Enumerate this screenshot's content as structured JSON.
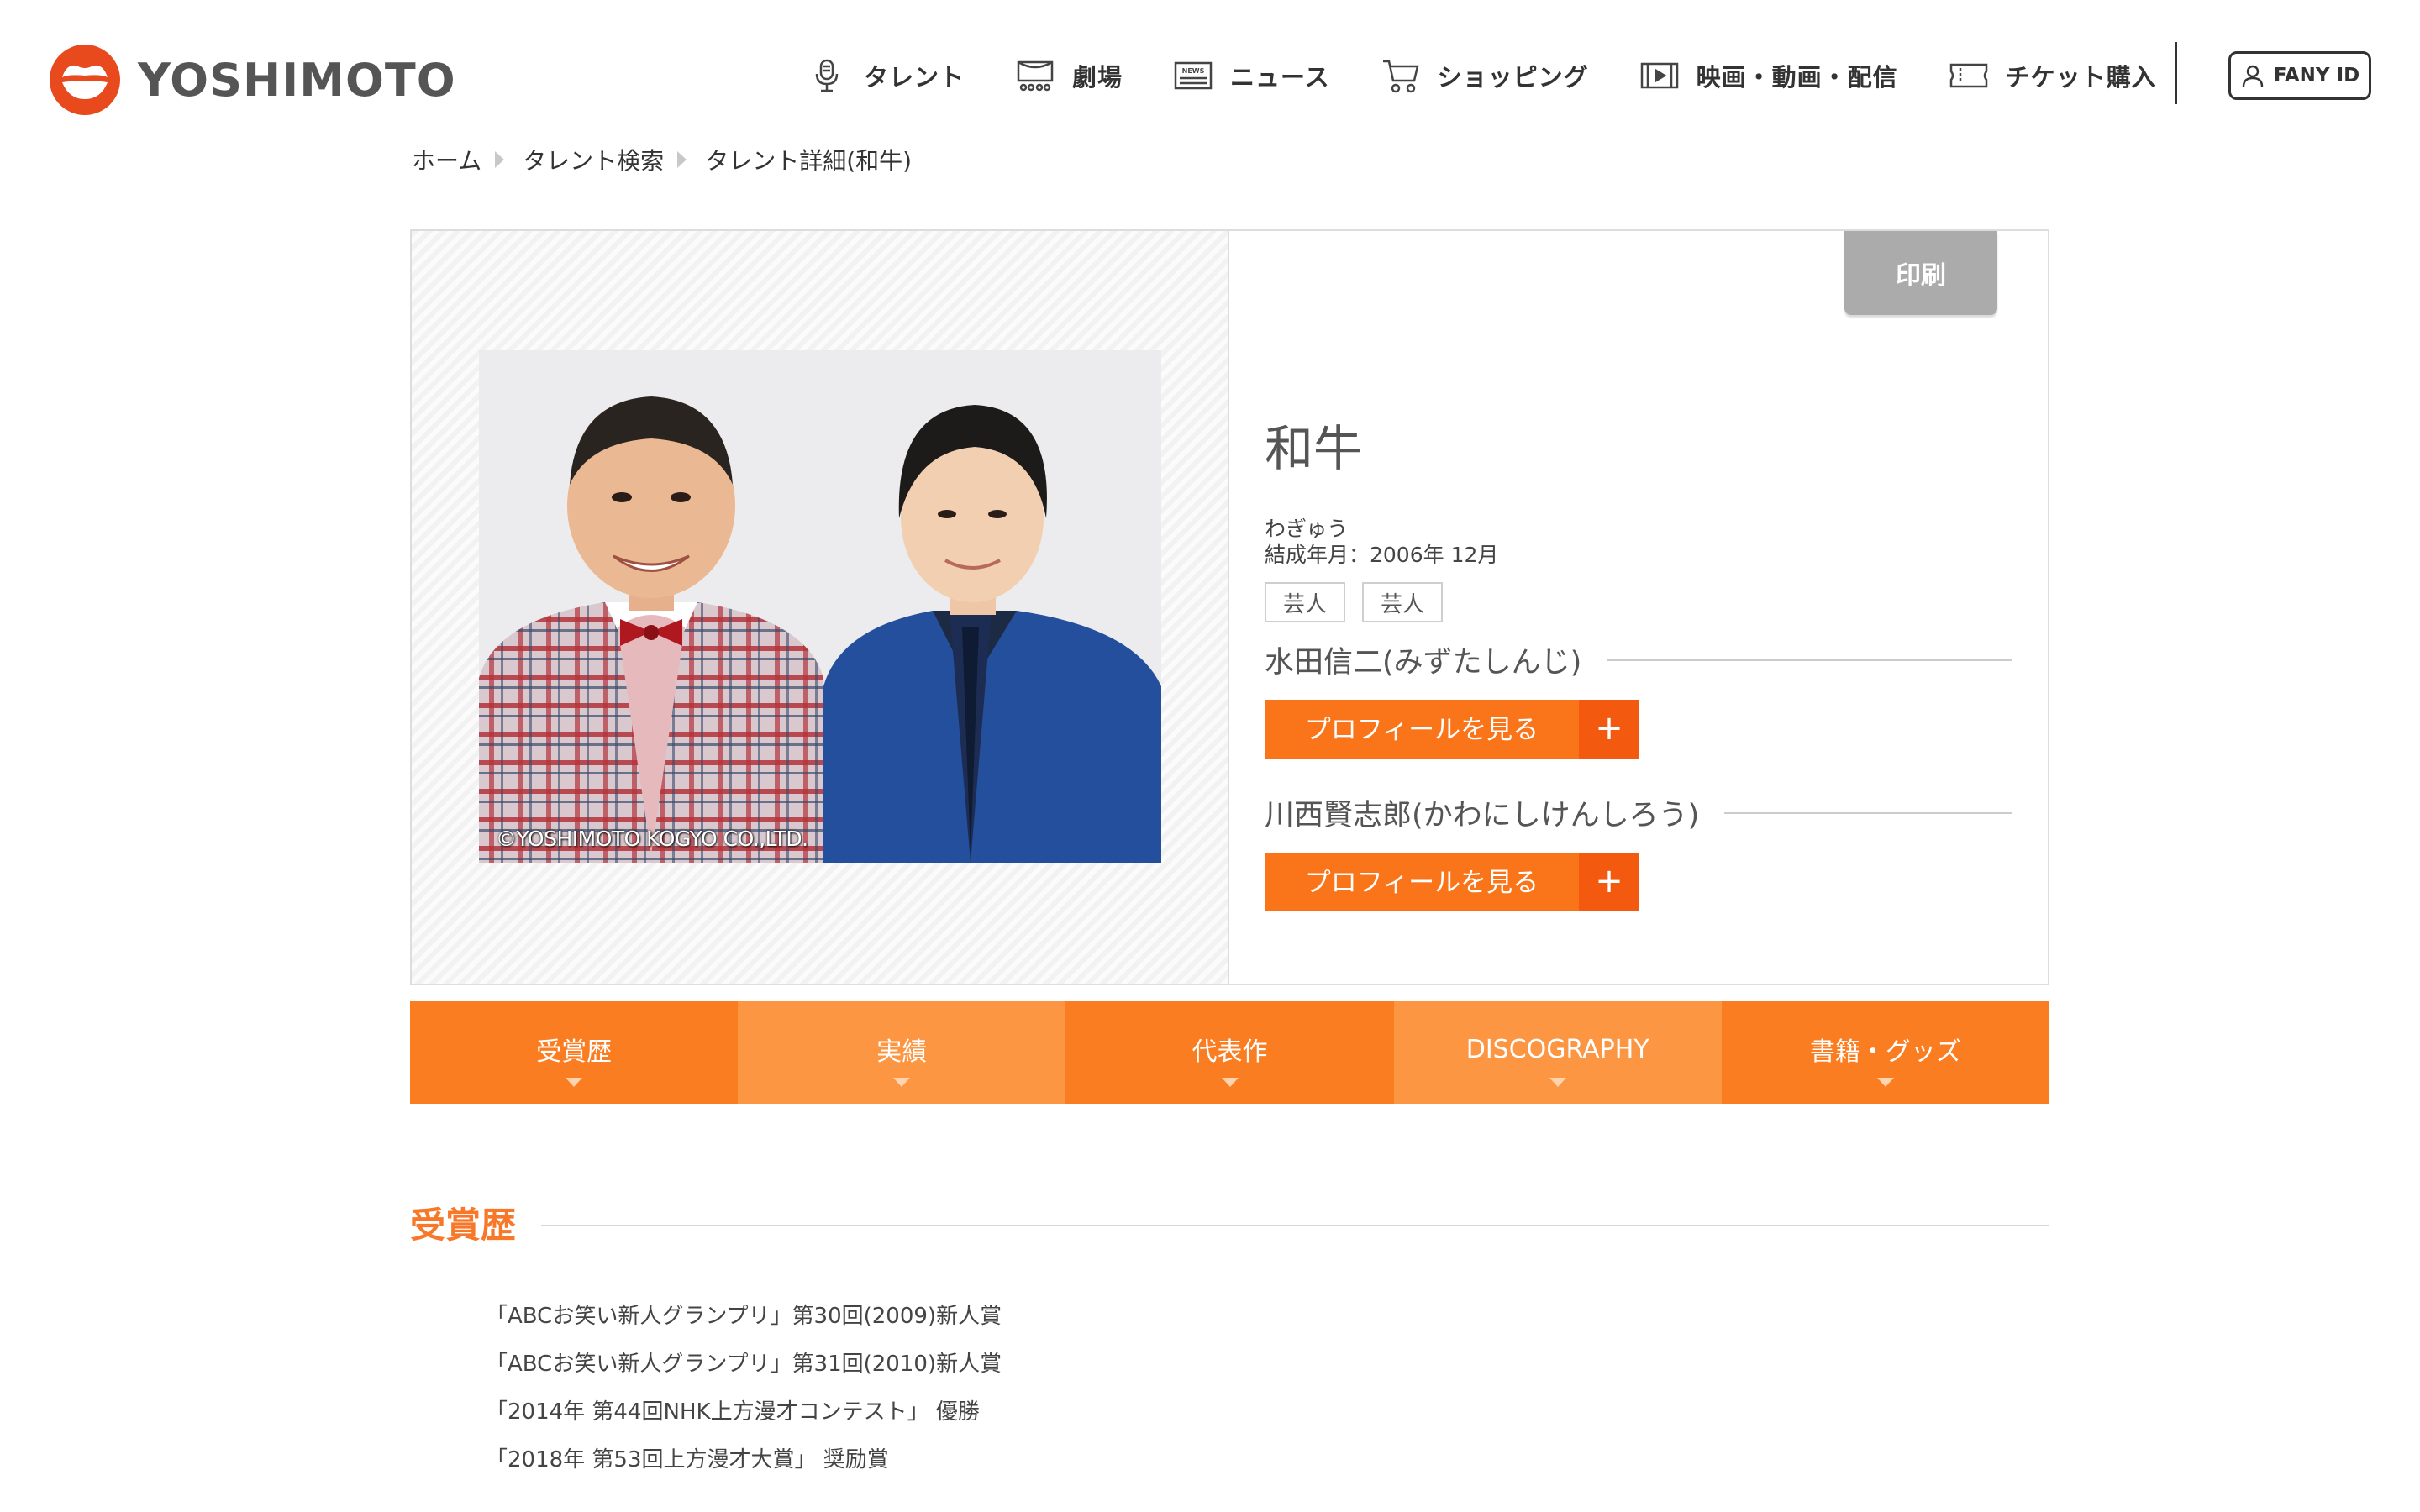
{
  "brand": {
    "logo_text": "YOSHIMOTO",
    "accent": "#fa7419",
    "logo_color": "#e8491d"
  },
  "nav": {
    "items": [
      {
        "label": "タレント",
        "icon": "microphone-icon"
      },
      {
        "label": "劇場",
        "icon": "theater-icon"
      },
      {
        "label": "ニュース",
        "icon": "news-icon"
      },
      {
        "label": "ショッピング",
        "icon": "cart-icon"
      },
      {
        "label": "映画・動画・配信",
        "icon": "film-icon"
      },
      {
        "label": "チケット購入",
        "icon": "ticket-icon"
      }
    ],
    "fany_label": "FANY ID"
  },
  "breadcrumb": [
    "ホーム",
    "タレント検索",
    "タレント詳細(和牛)"
  ],
  "profile": {
    "name": "和牛",
    "kana": "わぎゅう",
    "formed": "結成年月：2006年 12月",
    "tags": [
      "芸人",
      "芸人"
    ],
    "photo_copyright": "©YOSHIMOTO KOGYO CO.,LTD.",
    "print_label": "印刷",
    "members": [
      {
        "name": "水田信二(みずたしんじ)",
        "button_label": "プロフィールを見る",
        "button_plus": "+"
      },
      {
        "name": "川西賢志郎(かわにしけんしろう)",
        "button_label": "プロフィールを見る",
        "button_plus": "+"
      }
    ]
  },
  "tabs": [
    "受賞歴",
    "実績",
    "代表作",
    "DISCOGRAPHY",
    "書籍・グッズ"
  ],
  "awards_section": {
    "title": "受賞歴",
    "items": [
      "「ABCお笑い新人グランプリ」第30回(2009)新人賞",
      "「ABCお笑い新人グランプリ」第31回(2010)新人賞",
      "「2014年 第44回NHK上方漫才コンテスト」 優勝",
      "「2018年 第53回上方漫才大賞」 奨励賞"
    ]
  }
}
